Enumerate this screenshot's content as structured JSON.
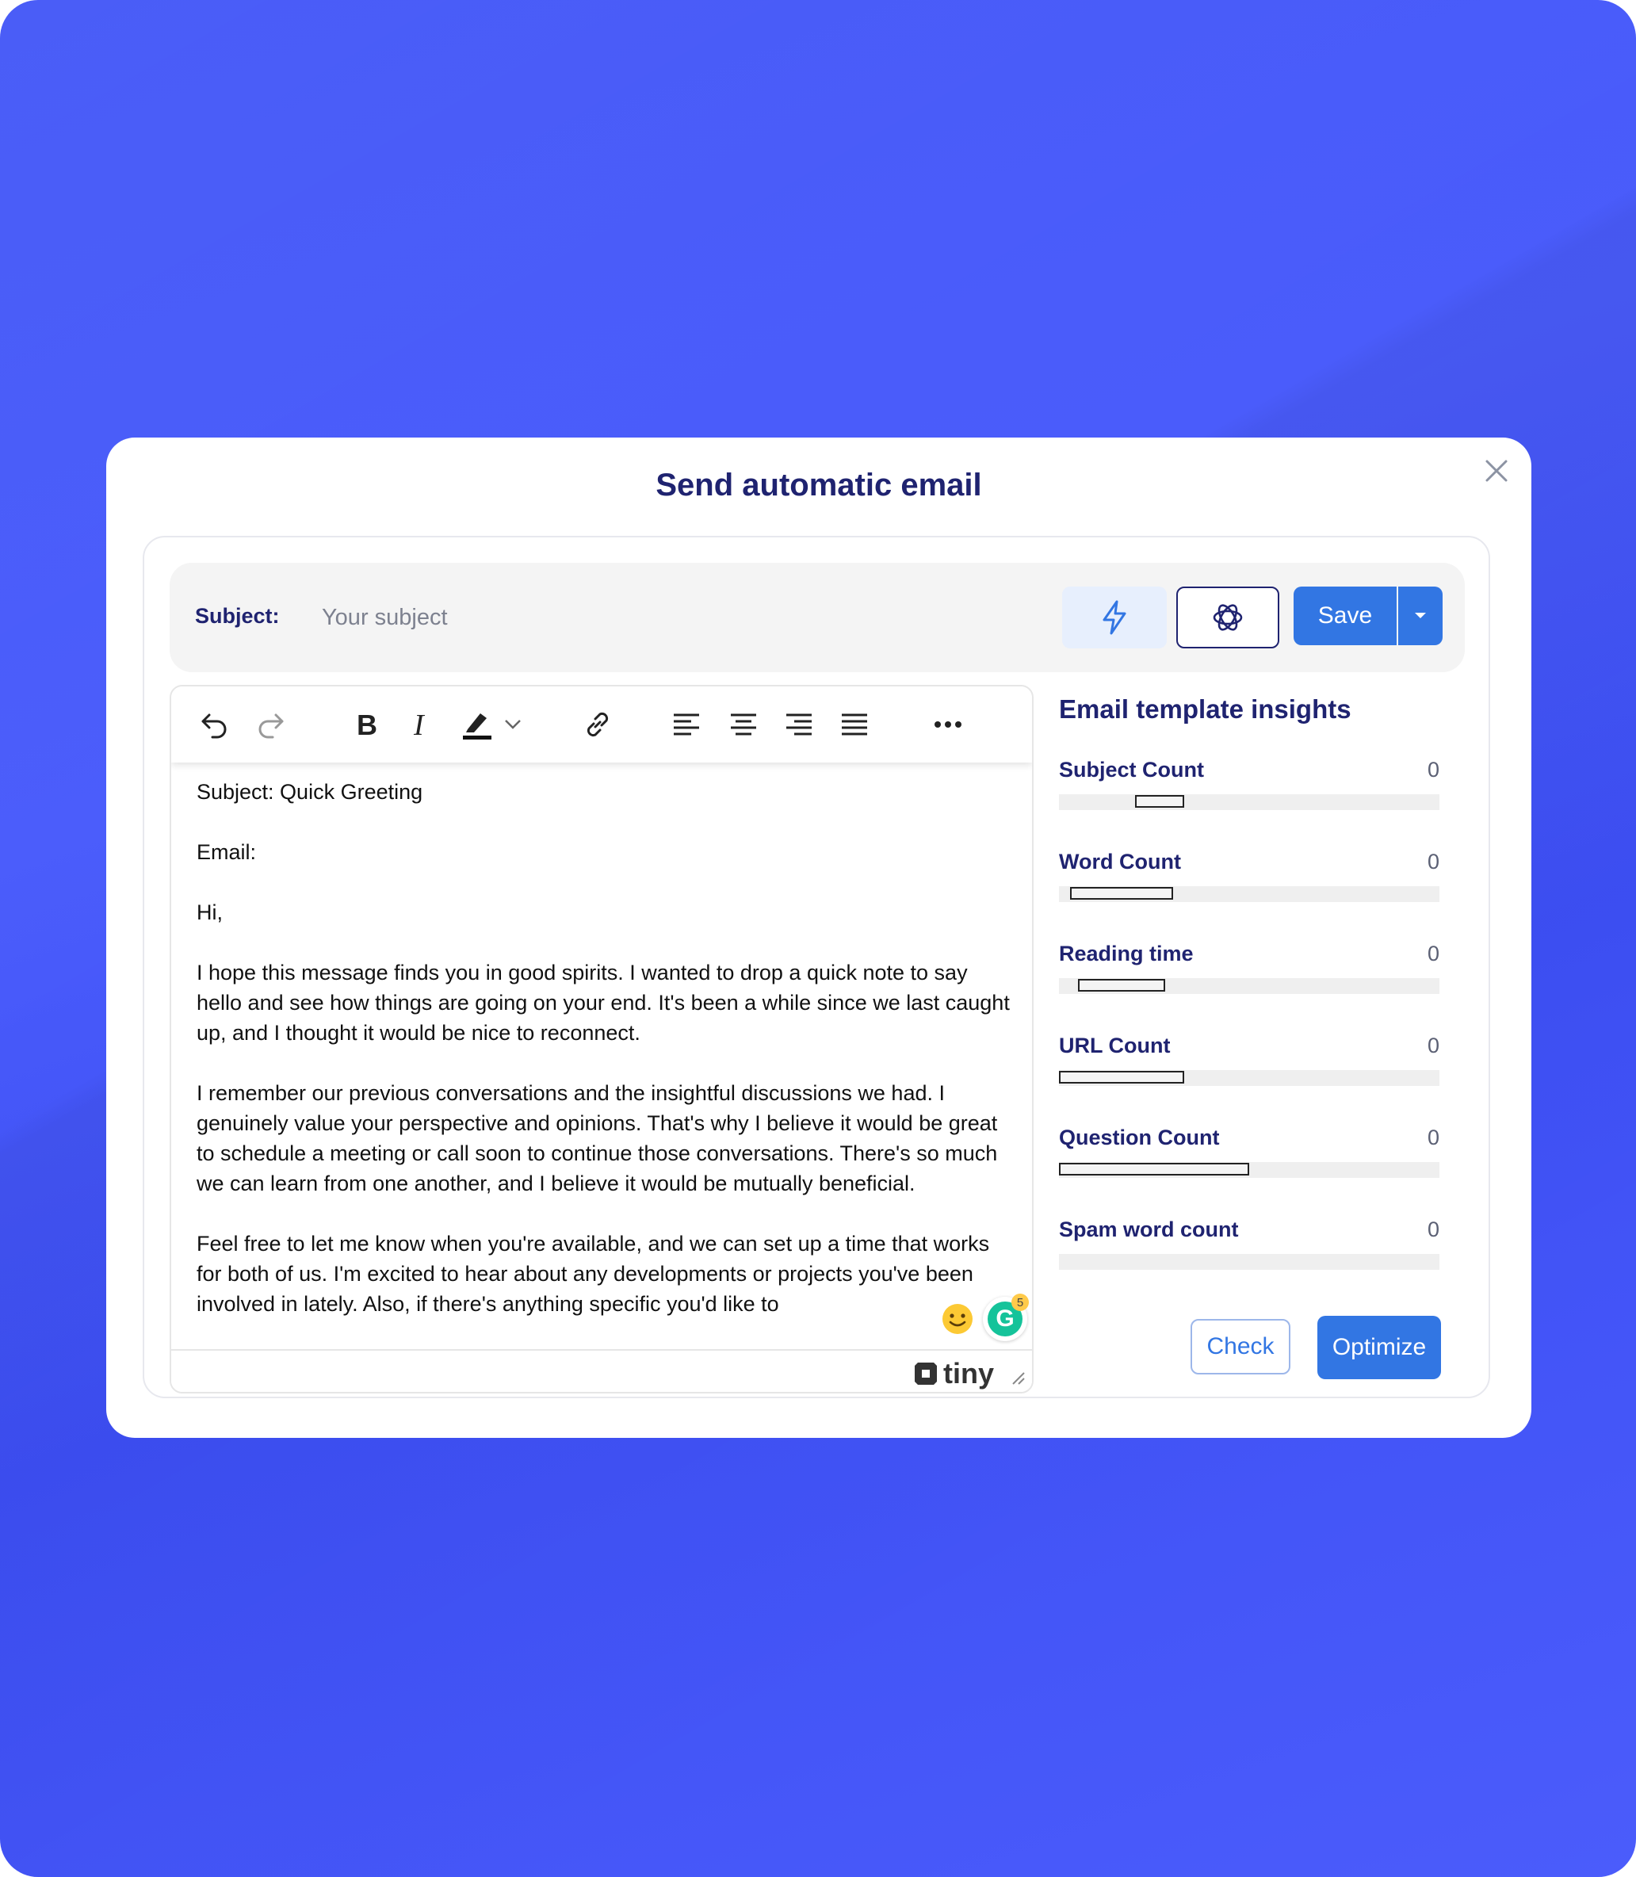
{
  "modal": {
    "title": "Send automatic email",
    "close_icon": "close-icon"
  },
  "subject_bar": {
    "label": "Subject:",
    "placeholder": "Your subject",
    "value": "",
    "bolt_icon": "lightning-bolt-icon",
    "ai_icon": "openai-icon",
    "save_label": "Save",
    "save_dropdown_icon": "caret-down-icon"
  },
  "toolbar": {
    "items": [
      "undo-icon",
      "redo-icon",
      "bold-icon",
      "italic-icon",
      "highlight-icon",
      "chevron-down-icon",
      "link-icon",
      "align-left-icon",
      "align-center-icon",
      "align-right-icon",
      "align-justify-icon",
      "more-icon"
    ]
  },
  "editor": {
    "paragraphs": [
      "Subject: Quick Greeting",
      "Email:",
      "Hi,",
      "I hope this message finds you in good spirits. I wanted to drop a quick note to say hello and see how things are going on your end. It's been a while since we last caught up, and I thought it would be nice to reconnect.",
      "I remember our previous conversations and the insightful discussions we had. I genuinely value your perspective and opinions. That's why I believe it would be great to schedule a meeting or call soon to continue those conversations. There's so much we can learn from one another, and I believe it would be mutually beneficial.",
      "Feel free to let me know when you're available, and we can set up a time that works for both of us. I'm excited to hear about any developments or projects you've been involved in lately. Also, if there's anything specific you'd like to"
    ],
    "brand": "tiny",
    "grammarly_badge": "5"
  },
  "insights": {
    "title": "Email template insights",
    "metrics": [
      {
        "label": "Subject Count",
        "value": "0",
        "range": [
          0.2,
          0.33
        ]
      },
      {
        "label": "Word Count",
        "value": "0",
        "range": [
          0.03,
          0.3
        ]
      },
      {
        "label": "Reading time",
        "value": "0",
        "range": [
          0.05,
          0.28
        ]
      },
      {
        "label": "URL Count",
        "value": "0",
        "range": [
          0.0,
          0.33
        ]
      },
      {
        "label": "Question Count",
        "value": "0",
        "range": [
          0.0,
          0.5
        ]
      },
      {
        "label": "Spam word count",
        "value": "0",
        "range": null
      }
    ],
    "check_label": "Check",
    "optimize_label": "Optimize"
  }
}
